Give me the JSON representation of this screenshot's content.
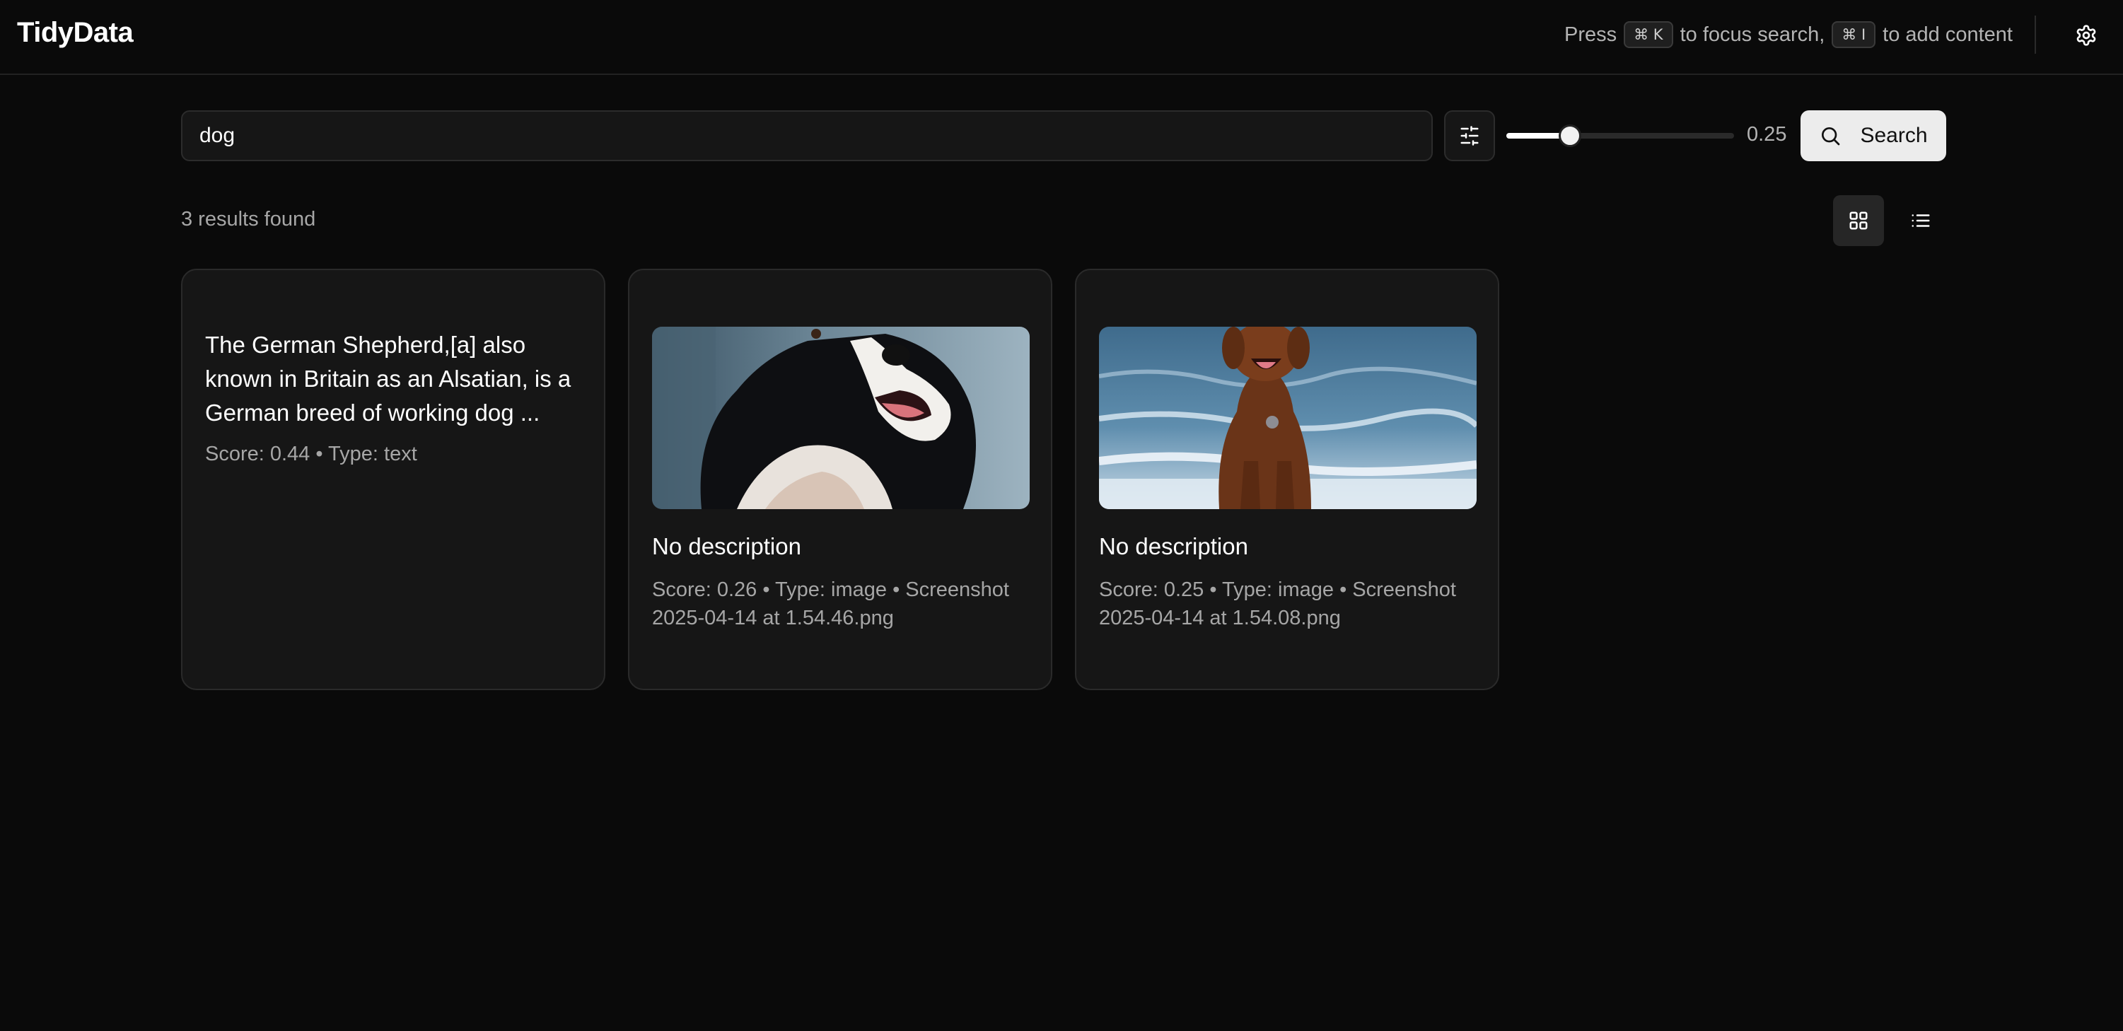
{
  "app": {
    "title": "TidyData"
  },
  "header": {
    "hint_press": "Press",
    "shortcut_search_key": "⌘ K",
    "hint_search": "to focus search,",
    "shortcut_add_key": "⌘ I",
    "hint_add": "to add content",
    "settings_icon": "gear-icon"
  },
  "search": {
    "query": "dog",
    "placeholder": "",
    "threshold": 0.25,
    "threshold_label": "0.25",
    "button_label": "Search"
  },
  "results": {
    "count_text": "3 results found",
    "view_mode": "grid",
    "items": [
      {
        "type": "text",
        "title": "The German Shepherd,[a] also known in Britain as an Alsatian, is a German breed of working dog ...",
        "meta": "Score: 0.44 • Type: text"
      },
      {
        "type": "image",
        "image": "border-collie-photo",
        "title": "No description",
        "meta": "Score: 0.26 • Type: image • Screenshot 2025-04-14 at 1.54.46.png"
      },
      {
        "type": "image",
        "image": "brown-retriever-beach-photo",
        "title": "No description",
        "meta": "Score: 0.25 • Type: image • Screenshot 2025-04-14 at 1.54.08.png"
      }
    ]
  },
  "colors": {
    "background": "#0a0a0a",
    "card": "#161616",
    "accent_button": "#ececec",
    "muted_text": "#a6a6a6"
  }
}
